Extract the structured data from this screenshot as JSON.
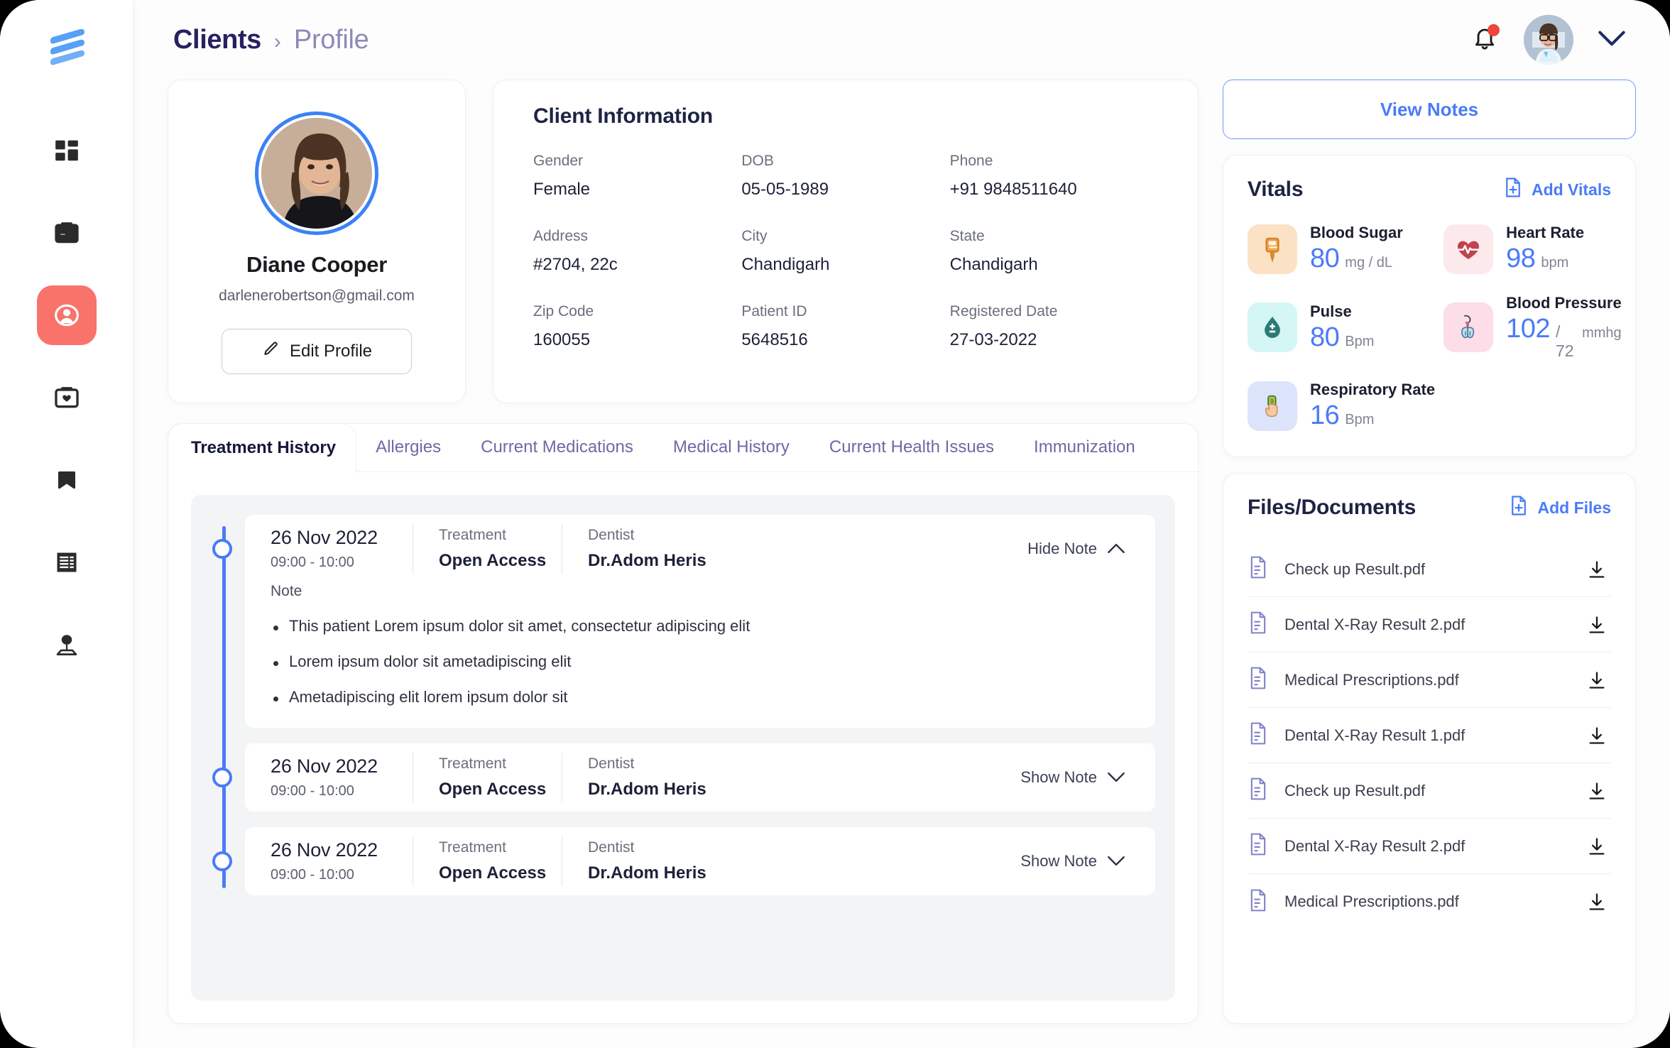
{
  "app": {
    "logo": "stacked-waves-logo",
    "accent_blue": "#4A7BF7",
    "accent_red": "#F9736B",
    "breadcrumb_color": "#262261"
  },
  "sidebar": {
    "items": [
      {
        "icon": "dashboard-grid-icon",
        "name": "dashboard",
        "active": false
      },
      {
        "icon": "calendar-icon",
        "name": "appointments",
        "active": false
      },
      {
        "icon": "user-circle-icon",
        "name": "clients",
        "active": true
      },
      {
        "icon": "calendar-heart-icon",
        "name": "treatments",
        "active": false
      },
      {
        "icon": "bookmark-icon",
        "name": "bookmarks",
        "active": false
      },
      {
        "icon": "invoice-icon",
        "name": "billing",
        "active": false
      },
      {
        "icon": "lamp-icon",
        "name": "settings",
        "active": false
      }
    ]
  },
  "header": {
    "breadcrumb_root": "Clients",
    "breadcrumb_sep": "›",
    "breadcrumb_current": "Profile",
    "notification_icon": "bell-icon",
    "has_notification_dot": true,
    "avatar": "doctor-avatar",
    "chevron": "chevron-down-icon"
  },
  "profile": {
    "name": "Diane Cooper",
    "email": "darlenerobertson@gmail.com",
    "edit_label": "Edit Profile",
    "edit_icon": "pencil-icon"
  },
  "client_information": {
    "title": "Client Information",
    "fields": [
      {
        "label": "Gender",
        "value": "Female"
      },
      {
        "label": "DOB",
        "value": "05-05-1989"
      },
      {
        "label": "Phone",
        "value": "+91 9848511640"
      },
      {
        "label": "Address",
        "value": "#2704, 22c"
      },
      {
        "label": "City",
        "value": "Chandigarh"
      },
      {
        "label": "State",
        "value": "Chandigarh"
      },
      {
        "label": "Zip Code",
        "value": "160055"
      },
      {
        "label": "Patient ID",
        "value": "5648516"
      },
      {
        "label": "Registered Date",
        "value": "27-03-2022"
      }
    ]
  },
  "tabs": [
    {
      "label": "Treatment History",
      "active": true
    },
    {
      "label": "Allergies",
      "active": false
    },
    {
      "label": "Current Medications",
      "active": false
    },
    {
      "label": "Medical History",
      "active": false
    },
    {
      "label": "Current Health Issues",
      "active": false
    },
    {
      "label": "Immunization",
      "active": false
    }
  ],
  "treatment_history": {
    "entries": [
      {
        "date": "26 Nov 2022",
        "time": "09:00 - 10:00",
        "treatment_label": "Treatment",
        "treatment_value": "Open Access",
        "dentist_label": "Dentist",
        "dentist_value": "Dr.Adom Heris",
        "toggle_label": "Hide Note",
        "toggle_icon": "chevron-up-icon",
        "expanded": true,
        "note_label": "Note",
        "notes": [
          "This patient Lorem ipsum dolor sit amet, consectetur adipiscing elit",
          "Lorem ipsum dolor sit ametadipiscing elit",
          "Ametadipiscing elit lorem ipsum dolor sit"
        ]
      },
      {
        "date": "26 Nov 2022",
        "time": "09:00 - 10:00",
        "treatment_label": "Treatment",
        "treatment_value": "Open Access",
        "dentist_label": "Dentist",
        "dentist_value": "Dr.Adom Heris",
        "toggle_label": "Show Note",
        "toggle_icon": "chevron-down-icon",
        "expanded": false,
        "note_label": "Note",
        "notes": []
      },
      {
        "date": "26 Nov 2022",
        "time": "09:00 - 10:00",
        "treatment_label": "Treatment",
        "treatment_value": "Open Access",
        "dentist_label": "Dentist",
        "dentist_value": "Dr.Adom Heris",
        "toggle_label": "Show Note",
        "toggle_icon": "chevron-down-icon",
        "expanded": false,
        "note_label": "Note",
        "notes": []
      }
    ]
  },
  "view_notes": {
    "label": "View Notes"
  },
  "vitals": {
    "title": "Vitals",
    "add_label": "Add Vitals",
    "add_icon": "file-plus-icon",
    "items": [
      {
        "name": "Blood Sugar",
        "value": "80",
        "unit": "mg / dL",
        "unit2": "",
        "icon": "glucometer-icon",
        "bg": "#FBE2C4"
      },
      {
        "name": "Heart Rate",
        "value": "98",
        "unit": "bpm",
        "unit2": "",
        "icon": "heart-pulse-icon",
        "bg": "#FCE9EC"
      },
      {
        "name": "Pulse",
        "value": "80",
        "unit": "Bpm",
        "unit2": "",
        "icon": "blood-drop-icon",
        "bg": "#D4F6F4"
      },
      {
        "name": "Blood Pressure",
        "value": "102",
        "unit": "/ 72",
        "unit2": "mmhg",
        "icon": "lungs-icon",
        "bg": "#FCDDE8"
      },
      {
        "name": "Respiratory Rate",
        "value": "16",
        "unit": "Bpm",
        "unit2": "",
        "icon": "oximeter-finger-icon",
        "bg": "#DCE4FB"
      }
    ]
  },
  "files": {
    "title": "Files/Documents",
    "add_label": "Add Files",
    "add_icon": "file-plus-icon",
    "items": [
      {
        "name": "Check up Result.pdf"
      },
      {
        "name": "Dental X-Ray Result 2.pdf"
      },
      {
        "name": "Medical Prescriptions.pdf"
      },
      {
        "name": "Dental X-Ray Result 1.pdf"
      },
      {
        "name": "Check up Result.pdf"
      },
      {
        "name": "Dental X-Ray Result 2.pdf"
      },
      {
        "name": "Medical Prescriptions.pdf"
      }
    ]
  }
}
